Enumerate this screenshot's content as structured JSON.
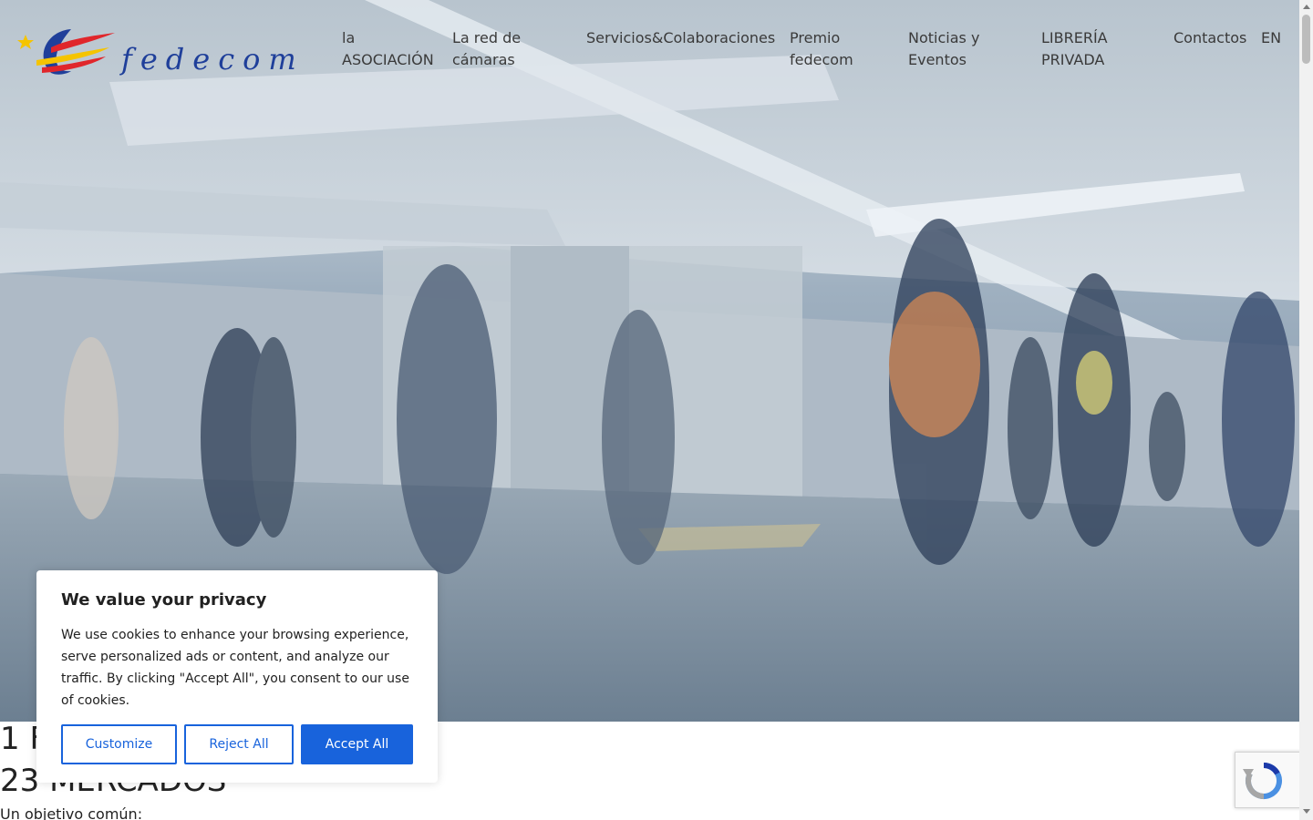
{
  "brand": {
    "name": "fedecom"
  },
  "nav": {
    "items": [
      {
        "label": "la ASOCIACIÓN"
      },
      {
        "label": "La red de cámaras"
      },
      {
        "label": "Servicios&Colaboraciones"
      },
      {
        "label": "Premio fedecom"
      },
      {
        "label": "Noticias y Eventos"
      },
      {
        "label": "LIBRERÍA PRIVADA"
      },
      {
        "label": "Contactos"
      },
      {
        "label": "EN"
      }
    ]
  },
  "hero": {
    "image": "blurred-commuters-walkway-photo"
  },
  "content": {
    "stat1": "1 F",
    "stat2": "23 MERCADOS",
    "objective": "Un objetivo común:"
  },
  "cookie": {
    "title": "We value your privacy",
    "text": "We use cookies to enhance your browsing experience, serve personalized ads or content, and analyze our traffic. By clicking \"Accept All\", you consent to our use of cookies.",
    "customize_label": "Customize",
    "reject_label": "Reject All",
    "accept_label": "Accept All"
  },
  "colors": {
    "brand_blue": "#1f3f9a",
    "brand_red": "#e0262b",
    "brand_yellow": "#f5c400",
    "button_blue": "#1863dc"
  },
  "icons": {
    "recaptcha": "recaptcha-icon",
    "scroll": "scrollbar"
  }
}
